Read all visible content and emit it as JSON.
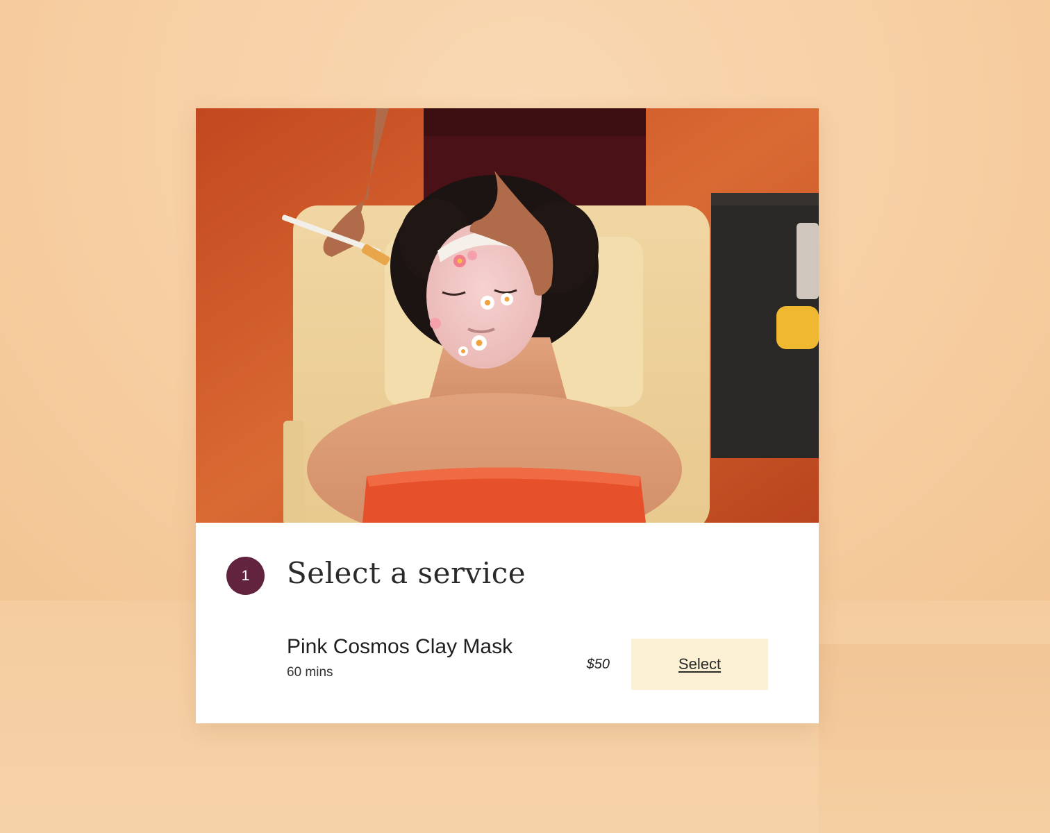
{
  "colors": {
    "background": "#f7d0a4",
    "card": "#ffffff",
    "step_circle": "#62233f",
    "button_bg": "#fbf0d4",
    "photo_backdrop": "#d4582b"
  },
  "hero_image": {
    "icon": "facial-treatment-photo"
  },
  "booking": {
    "step_number": "1",
    "step_title": "Select a service",
    "service": {
      "name": "Pink Cosmos Clay Mask",
      "duration": "60 mins",
      "price": "$50",
      "button_label": "Select"
    }
  }
}
